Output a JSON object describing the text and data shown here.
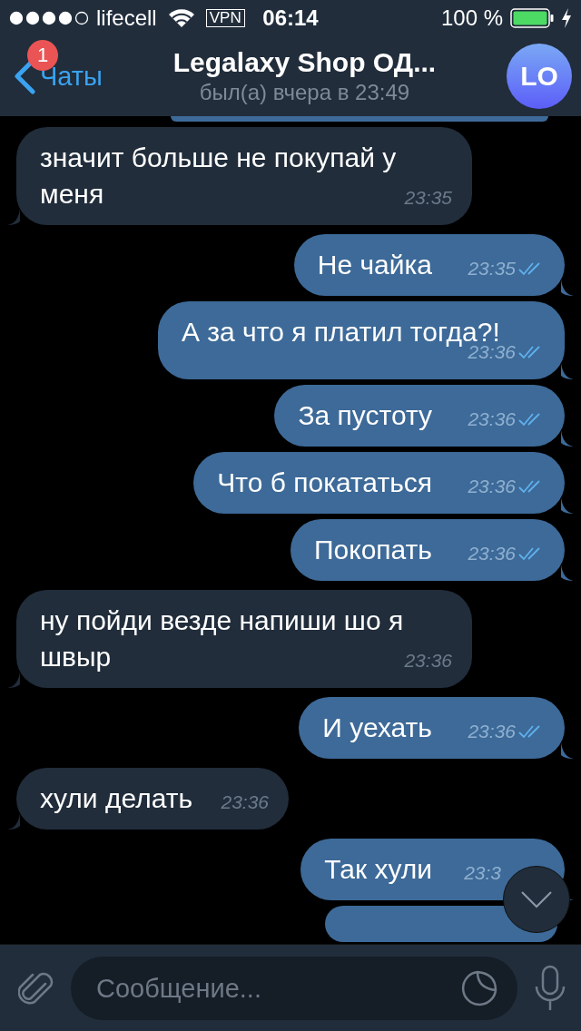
{
  "status_bar": {
    "carrier": "lifecell",
    "vpn": "VPN",
    "time": "06:14",
    "battery": "100 %"
  },
  "header": {
    "back": "Чаты",
    "badge": "1",
    "title": "Legalaxy Shop ОД...",
    "subtitle": "был(а) вчера в 23:49",
    "avatar": "LO"
  },
  "messages": [
    {
      "kind": "incoming",
      "text": "значит больше не покупай у меня",
      "time": "23:35"
    },
    {
      "kind": "outgoing",
      "text": "Не чайка",
      "time": "23:35",
      "read": true
    },
    {
      "kind": "outgoing",
      "text": "А за что я платил тогда?!",
      "time": "23:36",
      "read": true
    },
    {
      "kind": "outgoing",
      "text": "За пустоту",
      "time": "23:36",
      "read": true
    },
    {
      "kind": "outgoing",
      "text": "Что б покататься",
      "time": "23:36",
      "read": true
    },
    {
      "kind": "outgoing",
      "text": "Покопать",
      "time": "23:36",
      "read": true
    },
    {
      "kind": "incoming",
      "text": "ну пойди везде напиши шо я швыр",
      "time": "23:36"
    },
    {
      "kind": "outgoing",
      "text": "И уехать",
      "time": "23:36",
      "read": true
    },
    {
      "kind": "incoming",
      "text": "хули делать",
      "time": "23:36"
    },
    {
      "kind": "outgoing",
      "text": "Так хули",
      "time": "23:3"
    }
  ],
  "composer": {
    "placeholder": "Сообщение..."
  }
}
